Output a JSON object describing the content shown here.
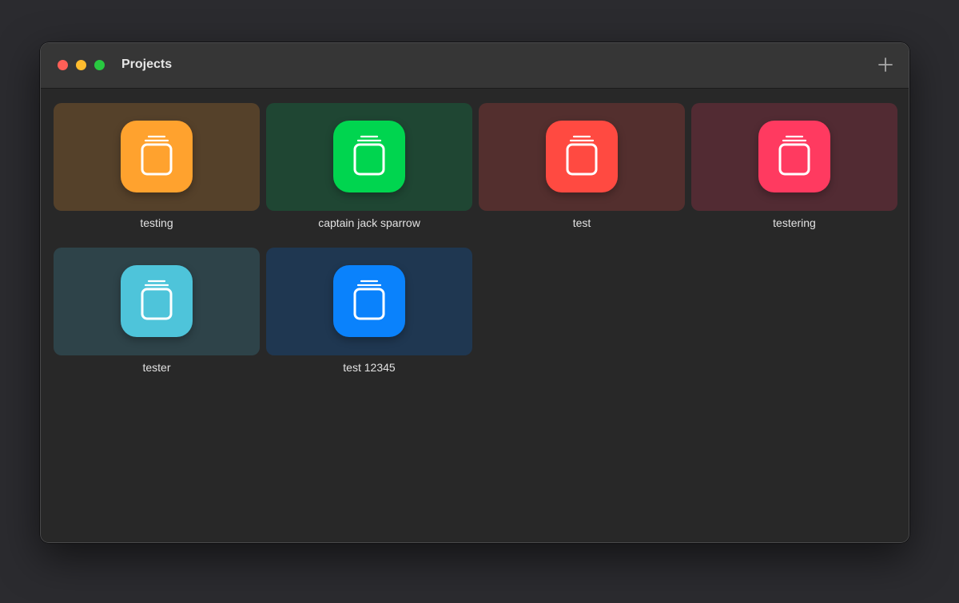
{
  "window": {
    "title": "Projects"
  },
  "projects": [
    {
      "name": "testing",
      "icon": "jar-icon",
      "tile_color": "#55412a",
      "icon_color": "#ffa22e"
    },
    {
      "name": "captain jack sparrow",
      "icon": "jar-icon",
      "tile_color": "#1f4633",
      "icon_color": "#00d54f"
    },
    {
      "name": "test",
      "icon": "jar-icon",
      "tile_color": "#532f2e",
      "icon_color": "#ff4a41"
    },
    {
      "name": "testering",
      "icon": "jar-icon",
      "tile_color": "#522b33",
      "icon_color": "#ff3a60"
    },
    {
      "name": "tester",
      "icon": "jar-icon",
      "tile_color": "#2e4349",
      "icon_color": "#4ec4da"
    },
    {
      "name": "test 12345",
      "icon": "jar-icon",
      "tile_color": "#1f3751",
      "icon_color": "#0a82fc"
    }
  ]
}
